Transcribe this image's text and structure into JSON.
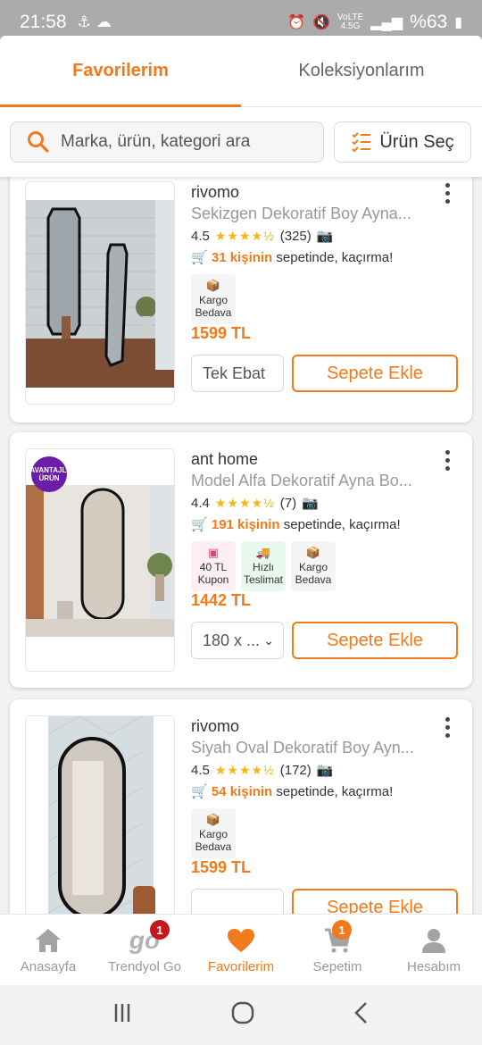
{
  "status_bar": {
    "time": "21:58",
    "battery": "%63",
    "network": "4.5G"
  },
  "tabs": [
    {
      "label": "Favorilerim",
      "active": true
    },
    {
      "label": "Koleksiyonlarım",
      "active": false
    }
  ],
  "search": {
    "placeholder": "Marka, ürün, kategori ara",
    "select_label": "Ürün Seç"
  },
  "products": [
    {
      "brand": "rivomo",
      "name": "Sekizgen Dekoratif Boy Ayna...",
      "rating": "4.5",
      "stars": "★★★★½",
      "reviews": "(325)",
      "basket_count": "31 kişinin",
      "basket_text": " sepetinde, kaçırma!",
      "badges": [
        {
          "label1": "Kargo",
          "label2": "Bedava",
          "icon": "box-icon"
        }
      ],
      "price": "1599 TL",
      "size": "Tek Ebat",
      "add_label": "Sepete Ekle"
    },
    {
      "brand": "ant home",
      "name": "Model Alfa Dekoratif Ayna Bo...",
      "rating": "4.4",
      "stars": "★★★★½",
      "reviews": "(7)",
      "basket_count": "191 kişinin",
      "basket_text": " sepetinde, kaçırma!",
      "advantage_badge": "AVANTAJLI ÜRÜN",
      "badges": [
        {
          "label1": "40 TL",
          "label2": "Kupon",
          "icon": "coupon-icon"
        },
        {
          "label1": "Hızlı",
          "label2": "Teslimat",
          "icon": "truck-icon"
        },
        {
          "label1": "Kargo",
          "label2": "Bedava",
          "icon": "box-icon"
        }
      ],
      "price": "1442 TL",
      "size": "180 x ...",
      "add_label": "Sepete Ekle"
    },
    {
      "brand": "rivomo",
      "name": "Siyah Oval Dekoratif Boy Ayn...",
      "rating": "4.5",
      "stars": "★★★★½",
      "reviews": "(172)",
      "basket_count": "54 kişinin",
      "basket_text": " sepetinde, kaçırma!",
      "badges": [
        {
          "label1": "Kargo",
          "label2": "Bedava",
          "icon": "box-icon"
        }
      ],
      "price": "1599 TL",
      "add_label": "Sepete Ekle"
    }
  ],
  "bottom_nav": [
    {
      "label": "Anasayfa",
      "icon": "home-icon"
    },
    {
      "label": "Trendyol Go",
      "icon": "go-icon",
      "badge": "1"
    },
    {
      "label": "Favorilerim",
      "icon": "heart-icon",
      "active": true
    },
    {
      "label": "Sepetim",
      "icon": "cart-icon",
      "badge": "1"
    },
    {
      "label": "Hesabım",
      "icon": "user-icon"
    }
  ],
  "colors": {
    "accent": "#f27a1a",
    "badge_red": "#c4171e",
    "star": "#f9b40e"
  }
}
